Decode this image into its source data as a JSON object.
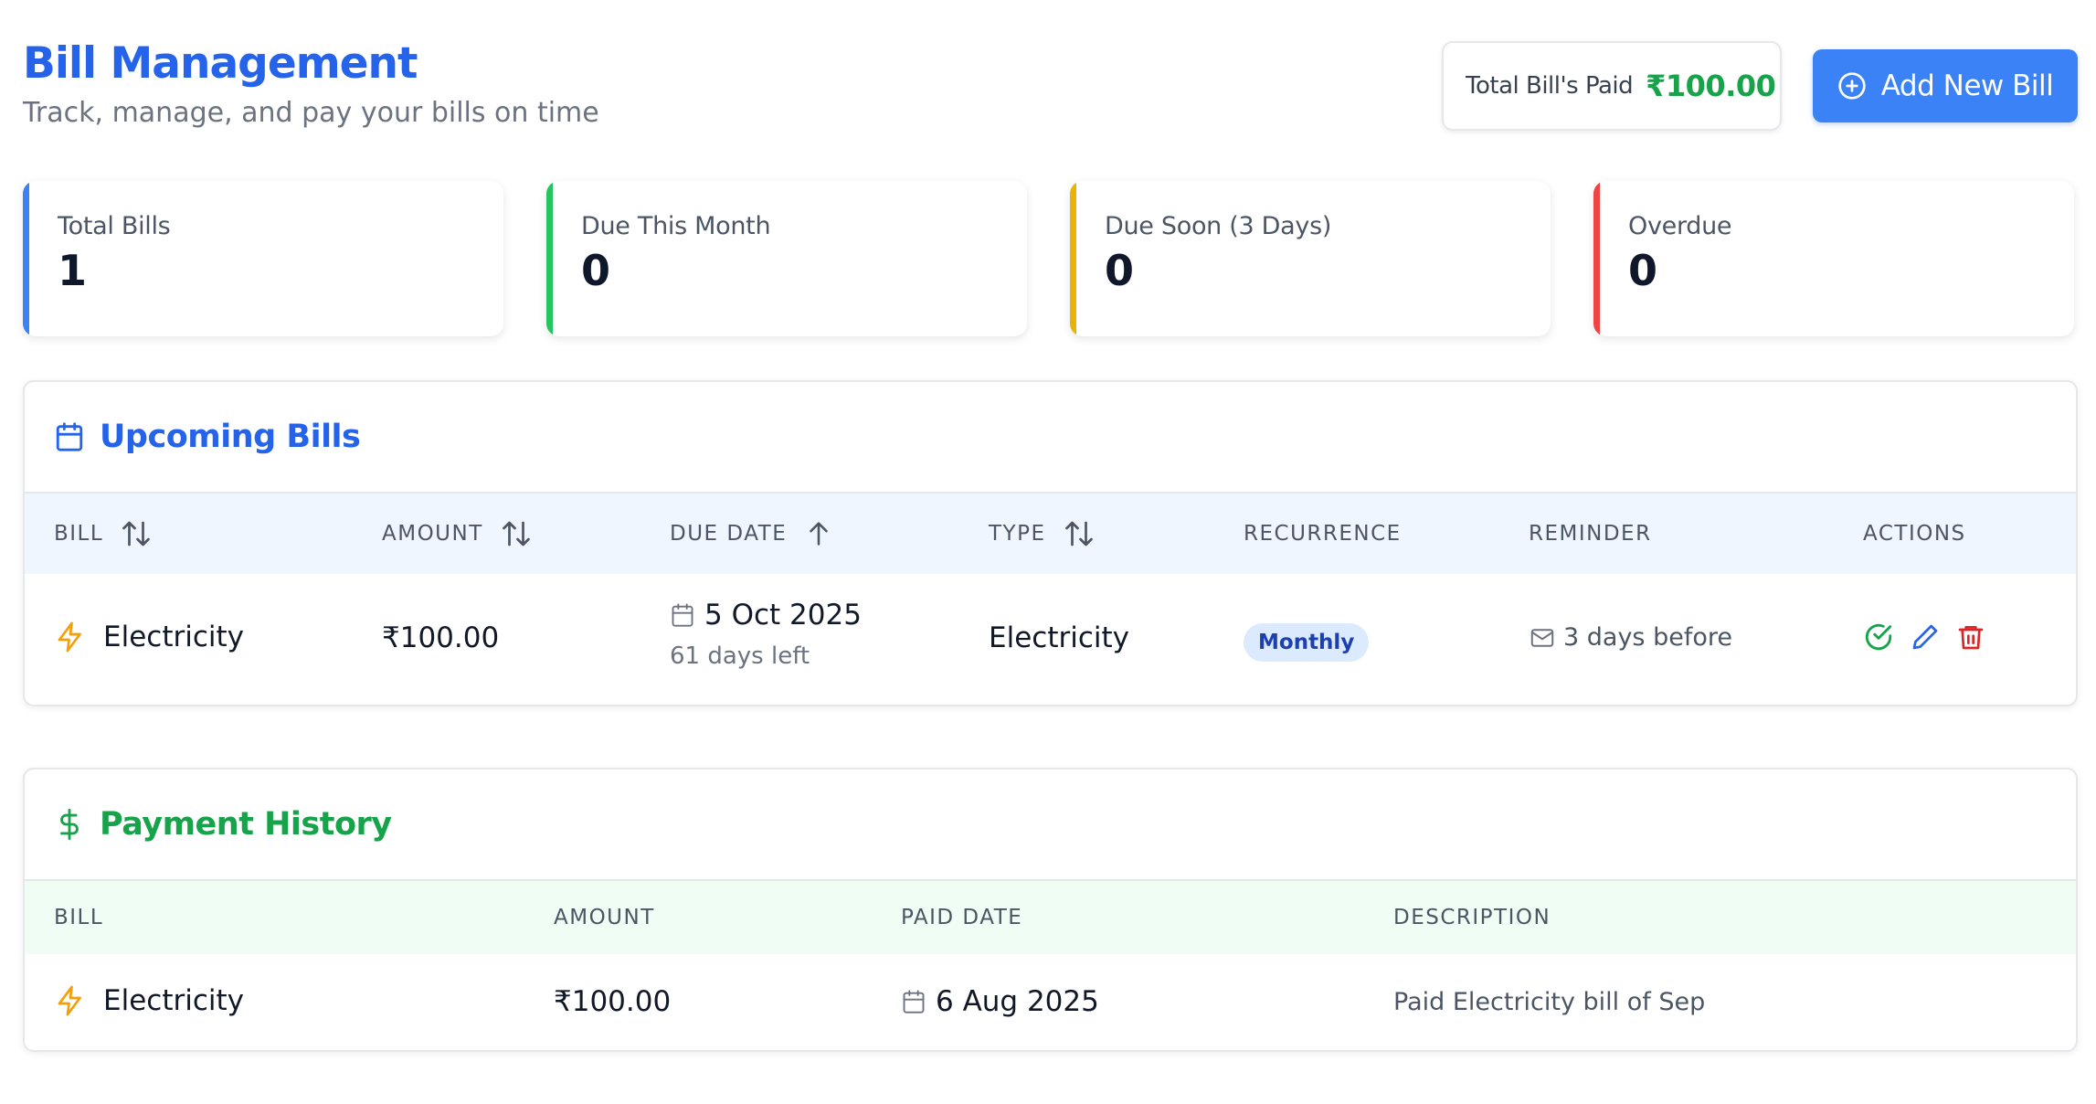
{
  "header": {
    "title": "Bill Management",
    "subtitle": "Track, manage, and pay your bills on time",
    "total_paid_label": "Total Bill's Paid",
    "total_paid_value": "₹100.00",
    "add_button_label": "Add New Bill"
  },
  "stats": [
    {
      "label": "Total Bills",
      "value": "1",
      "color": "#3b82f6"
    },
    {
      "label": "Due This Month",
      "value": "0",
      "color": "#22c55e"
    },
    {
      "label": "Due Soon (3 Days)",
      "value": "0",
      "color": "#eab308"
    },
    {
      "label": "Overdue",
      "value": "0",
      "color": "#ef4444"
    }
  ],
  "upcoming": {
    "title": "Upcoming Bills",
    "title_color": "#2563eb",
    "header_bg": "#eff6ff",
    "columns": [
      "BILL",
      "AMOUNT",
      "DUE DATE",
      "TYPE",
      "RECURRENCE",
      "REMINDER",
      "ACTIONS"
    ],
    "rows": [
      {
        "bill": "Electricity",
        "amount": "₹100.00",
        "due_date": "5 Oct 2025",
        "days_left": "61 days left",
        "type": "Electricity",
        "recurrence": "Monthly",
        "reminder": "3 days before"
      }
    ]
  },
  "history": {
    "title": "Payment History",
    "title_color": "#16a34a",
    "header_bg": "#f0fdf4",
    "columns": [
      "BILL",
      "AMOUNT",
      "PAID DATE",
      "DESCRIPTION"
    ],
    "rows": [
      {
        "bill": "Electricity",
        "amount": "₹100.00",
        "paid_date": "6 Aug 2025",
        "description": "Paid Electricity bill of Sep"
      }
    ]
  },
  "icons": {
    "add": "plus-circle-icon",
    "calendar": "calendar-icon",
    "dollar": "dollar-icon",
    "bolt": "lightning-bolt-icon",
    "mail": "mail-icon",
    "sort": "sort-arrows-icon",
    "sort_asc": "arrow-up-icon",
    "paid": "check-circle-icon",
    "edit": "pencil-icon",
    "delete": "trash-icon"
  }
}
